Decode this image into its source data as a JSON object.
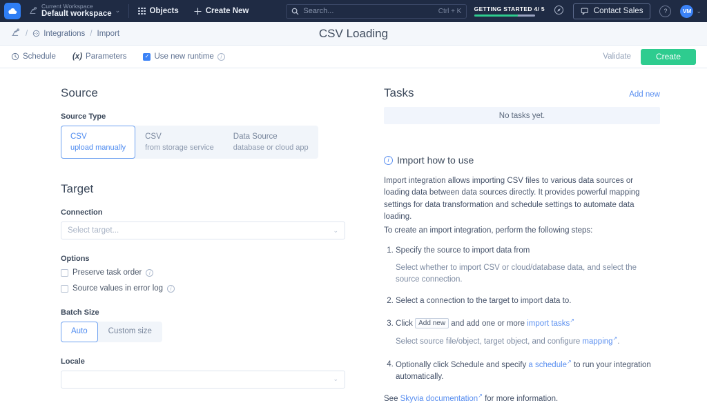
{
  "topnav": {
    "logo_icon": "cloud-logo-icon",
    "workspace": {
      "caption": "Current Workspace",
      "name": "Default workspace",
      "chevron": "⌄"
    },
    "objects_label": "Objects",
    "create_new_label": "Create New",
    "create_new_icon": "plus-icon",
    "search": {
      "placeholder": "Search...",
      "shortcut": "Ctrl + K",
      "icon": "search-icon"
    },
    "getting_started": {
      "label": "GETTING STARTED 4/ 5",
      "progress_percent": 72,
      "bar_color": "#2ecc8f"
    },
    "compass_icon": "compass-icon",
    "contact_sales_label": "Contact Sales",
    "contact_sales_icon": "chat-icon",
    "help_icon": "question-icon",
    "avatar_initials": "VM",
    "avatar_color": "#3b82f6"
  },
  "breadcrumb": {
    "home_icon": "integration-home-icon",
    "sep": "/",
    "items": [
      {
        "label": "Integrations",
        "icon": "gear-circle-icon"
      },
      {
        "label": "Import",
        "icon": ""
      }
    ]
  },
  "page": {
    "title": "CSV Loading"
  },
  "toolbar": {
    "schedule_label": "Schedule",
    "schedule_icon": "clock-icon",
    "parameters_label": "Parameters",
    "parameters_icon": "(x)",
    "runtime_label": "Use new runtime",
    "runtime_checked": true,
    "runtime_info_icon": "info-icon",
    "validate_label": "Validate",
    "create_label": "Create",
    "create_color": "#2ecc8f"
  },
  "source": {
    "heading": "Source",
    "type_label": "Source Type",
    "options": [
      {
        "title": "CSV",
        "subtitle": "upload manually",
        "selected": true
      },
      {
        "title": "CSV",
        "subtitle": "from storage service",
        "selected": false
      },
      {
        "title": "Data Source",
        "subtitle": "database or cloud app",
        "selected": false
      }
    ]
  },
  "target": {
    "heading": "Target",
    "connection_label": "Connection",
    "connection_placeholder": "Select target...",
    "options_label": "Options",
    "checkboxes": [
      {
        "label": "Preserve task order",
        "checked": false
      },
      {
        "label": "Source values in error log",
        "checked": false
      }
    ],
    "batch_label": "Batch Size",
    "batch_options": [
      {
        "title": "Auto",
        "selected": true
      },
      {
        "title": "Custom size",
        "selected": false
      }
    ],
    "locale_label": "Locale",
    "locale_value": ""
  },
  "tasks": {
    "heading": "Tasks",
    "add_new_label": "Add new",
    "empty_text": "No tasks yet."
  },
  "howto": {
    "heading": "Import how to use",
    "intro": "Import integration allows importing CSV files to various data sources or loading data between data sources directly. It provides powerful mapping settings for data transformation and schedule settings to automate data loading.",
    "intro2": "To create an import integration, perform the following steps:",
    "steps": [
      {
        "text": "Specify the source to import data from",
        "sub": "Select whether to import CSV or cloud/database data, and select the source connection."
      },
      {
        "text": "Select a connection to the target to import data to.",
        "sub": ""
      },
      {
        "pre": "Click",
        "kbd": "Add new",
        "mid": "and add one or more",
        "link": "import tasks",
        "sub_pre": "Select source file/object, target object, and configure",
        "sub_link": "mapping",
        "sub_post": "."
      },
      {
        "pre": "Optionally click Schedule and specify",
        "link": "a schedule",
        "post": "to run your integration automatically."
      }
    ],
    "footer_pre": "See",
    "footer_link": "Skyvia documentation",
    "footer_post": "for more information."
  }
}
